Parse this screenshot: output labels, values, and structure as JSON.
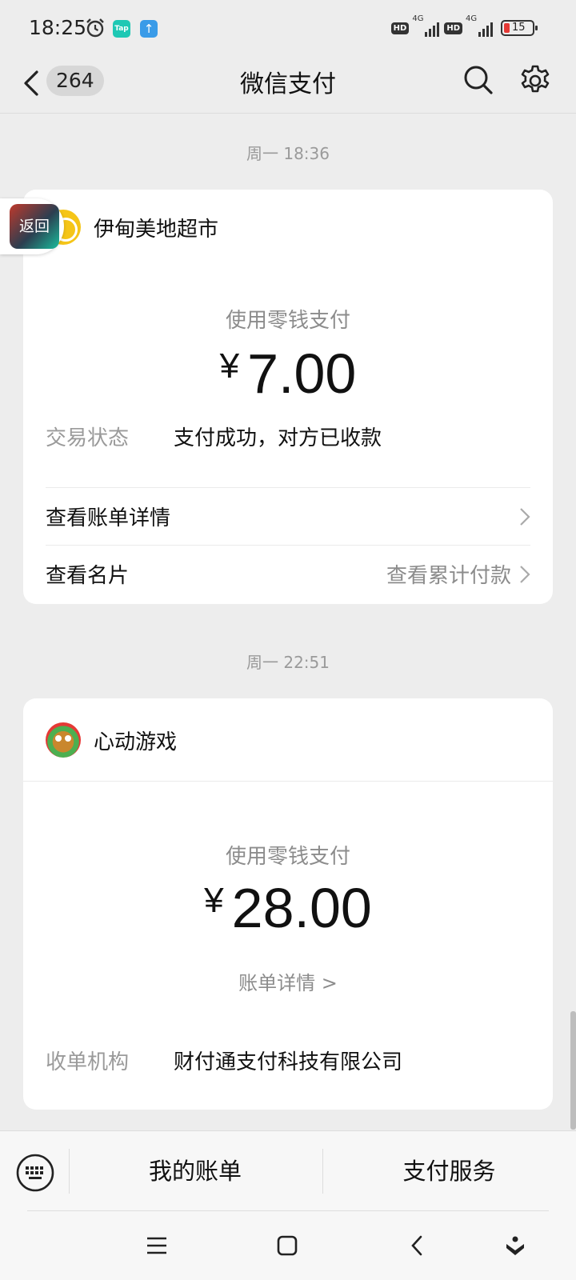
{
  "status_bar": {
    "time": "18:25",
    "tap_label": "Tap",
    "hd1": "HD",
    "net1": "4G",
    "hd2": "HD",
    "net2": "4G",
    "battery": "15",
    "icons": [
      "alarm-icon",
      "tap-app-icon",
      "upload-app-icon",
      "signal-icon",
      "battery-icon"
    ]
  },
  "nav": {
    "back_count": "264",
    "title": "微信支付"
  },
  "messages": [
    {
      "timestamp": "周一 18:36",
      "merchant": "伊甸美地超市",
      "pay_method": "使用零钱支付",
      "currency": "¥",
      "amount": "7.00",
      "status_key": "交易状态",
      "status_value": "支付成功，对方已收款",
      "row1_label": "查看账单详情",
      "row2_label": "查看名片",
      "row2_extra": "查看累计付款"
    },
    {
      "timestamp": "周一 22:51",
      "merchant": "心动游戏",
      "pay_method": "使用零钱支付",
      "currency": "¥",
      "amount": "28.00",
      "detail_link": "账单详情 >",
      "org_key": "收单机构",
      "org_value": "财付通支付科技有限公司"
    }
  ],
  "floating_back": "返回",
  "bottom_bar": {
    "left": "我的账单",
    "right": "支付服务"
  },
  "colors": {
    "background": "#ededed",
    "card": "#ffffff",
    "muted_text": "#8c8c8c",
    "merchant_logo_1": "#f5c518"
  }
}
